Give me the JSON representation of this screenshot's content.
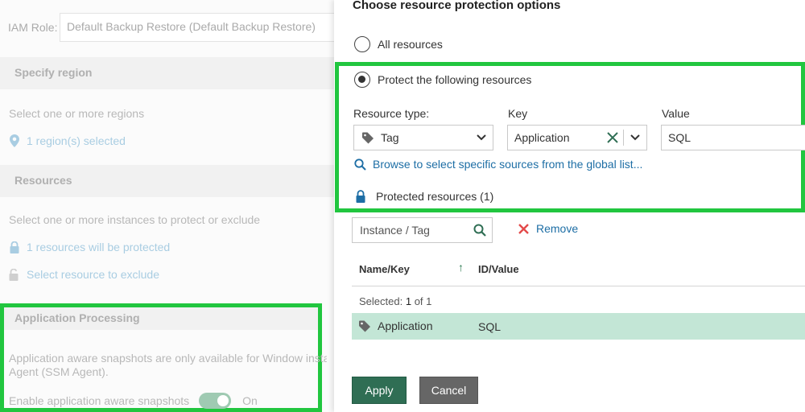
{
  "background": {
    "iam_role_label": "IAM Role:",
    "iam_role_value": "Default Backup Restore (Default Backup Restore)",
    "region_section": "Specify region",
    "region_hint": "Select one or more regions",
    "region_link": "1 region(s) selected",
    "resources_section": "Resources",
    "resources_hint": "Select one or more instances to protect or exclude",
    "protected_link": "1 resources will be protected",
    "exclude_link": "Select resource to exclude",
    "app_section": "Application Processing",
    "app_desc_line1": "Application aware snapshots are only available for Window instances",
    "app_desc_line2": "Agent (SSM Agent).",
    "app_toggle_label": "Enable application aware snapshots",
    "app_toggle_value": "On"
  },
  "panel": {
    "title": "Choose resource protection options",
    "option_all": "All resources",
    "option_following": "Protect the following resources",
    "resource_type_label": "Resource type:",
    "resource_type_value": "Tag",
    "key_label": "Key",
    "key_value": "Application",
    "value_label": "Value",
    "value_value": "SQL",
    "browse_link": "Browse to select specific sources from the global list...",
    "protected_label": "Protected resources (1)",
    "search_placeholder": "Instance / Tag",
    "remove_label": "Remove",
    "col_name": "Name/Key",
    "col_id": "ID/Value",
    "selected_prefix": "Selected:",
    "selected_count": "1",
    "selected_suffix": "of 1",
    "row_name": "Application",
    "row_value": "SQL",
    "apply_label": "Apply",
    "cancel_label": "Cancel"
  },
  "colors": {
    "highlight": "#21c63f",
    "accent": "#2f6e54",
    "link": "#1d6ea5",
    "selected_row": "#c3e6d6"
  }
}
